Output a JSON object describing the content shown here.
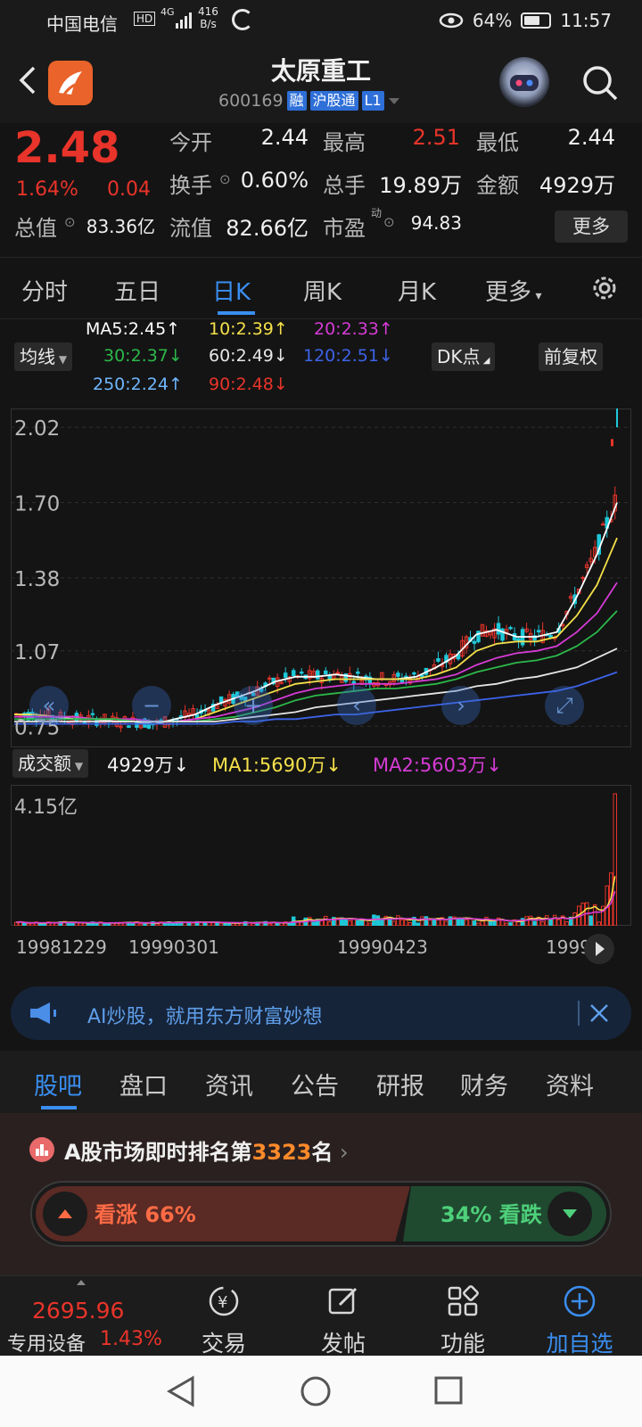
{
  "status_bar": {
    "carrier": "中国电信",
    "hd": "HD",
    "net_type": "4G",
    "speed_value": "416",
    "speed_unit": "B/s",
    "battery_pct": "64%",
    "battery_level": 0.64,
    "time": "11:57"
  },
  "header": {
    "title": "太原重工",
    "code": "600169",
    "tag_rong": "融",
    "tag_hgt": "沪股通",
    "tag_l1": "L1"
  },
  "quote": {
    "price": "2.48",
    "change_pct": "1.64%",
    "change": "0.04",
    "open_label": "今开",
    "open": "2.44",
    "high_label": "最高",
    "high": "2.51",
    "low_label": "最低",
    "low": "2.44",
    "turnover_label": "换手",
    "turnover": "0.60%",
    "volume_label": "总手",
    "volume": "19.89万",
    "amount_label": "金额",
    "amount": "4929万",
    "mktcap_label": "总值",
    "mktcap": "83.36亿",
    "float_label": "流值",
    "float_cap": "82.66亿",
    "pe_label": "市盈",
    "pe_sup": "动",
    "pe": "94.83",
    "more": "更多"
  },
  "period_tabs": [
    "分时",
    "五日",
    "日K",
    "周K",
    "月K",
    "更多"
  ],
  "active_tab": "日K",
  "ma_legend": {
    "mode": "均线",
    "dk": "DK点",
    "adjust": "前复权",
    "ma5": "MA5:2.45↑",
    "ma10": "10:2.39↑",
    "ma20": "20:2.33↑",
    "ma30": "30:2.37↓",
    "ma60": "60:2.49↓",
    "ma120": "120:2.51↓",
    "ma250": "250:2.24↑",
    "ma90": "90:2.48↓"
  },
  "colors": {
    "up": "#e8342a",
    "down": "#1fc8d8",
    "ma5": "#ffffff",
    "ma10": "#f5e04a",
    "ma20": "#d63bd6",
    "ma30": "#2cb84a",
    "ma60": "#e6e6e6",
    "ma120": "#3c63e8",
    "ma250": "#6fb7ff",
    "ma90": "#e8342a",
    "accent": "#3a8ef0"
  },
  "chart_data": [
    {
      "type": "candlestick",
      "y_ticks": [
        "2.02",
        "1.70",
        "1.38",
        "1.07",
        "0.75"
      ],
      "ylim": [
        0.75,
        2.02
      ],
      "x_ticks": [
        "19981229",
        "19990301",
        "19990423",
        "1999"
      ],
      "series": [
        {
          "name": "MA5",
          "values": [
            0.8,
            0.8,
            0.79,
            0.78,
            0.78,
            0.77,
            0.77,
            0.76,
            0.78,
            0.8,
            0.84,
            0.87,
            0.9,
            0.94,
            0.96,
            0.96,
            0.97,
            0.96,
            0.95,
            0.95,
            0.96,
            1.0,
            1.05,
            1.14,
            1.16,
            1.13,
            1.13,
            1.15,
            1.3,
            1.48,
            1.7
          ]
        },
        {
          "name": "MA10",
          "values": [
            0.8,
            0.8,
            0.79,
            0.79,
            0.78,
            0.78,
            0.77,
            0.77,
            0.77,
            0.78,
            0.81,
            0.84,
            0.87,
            0.9,
            0.93,
            0.94,
            0.95,
            0.95,
            0.95,
            0.95,
            0.95,
            0.97,
            1.0,
            1.07,
            1.1,
            1.11,
            1.11,
            1.13,
            1.22,
            1.35,
            1.55
          ]
        },
        {
          "name": "MA20",
          "values": [
            0.79,
            0.79,
            0.79,
            0.79,
            0.78,
            0.78,
            0.78,
            0.77,
            0.77,
            0.78,
            0.79,
            0.81,
            0.83,
            0.86,
            0.89,
            0.91,
            0.92,
            0.93,
            0.93,
            0.93,
            0.94,
            0.95,
            0.97,
            1.01,
            1.04,
            1.06,
            1.07,
            1.09,
            1.15,
            1.23,
            1.36
          ]
        },
        {
          "name": "MA30",
          "values": [
            0.78,
            0.78,
            0.78,
            0.78,
            0.78,
            0.78,
            0.77,
            0.77,
            0.77,
            0.77,
            0.78,
            0.79,
            0.81,
            0.83,
            0.86,
            0.88,
            0.89,
            0.9,
            0.91,
            0.91,
            0.92,
            0.93,
            0.95,
            0.98,
            1.0,
            1.02,
            1.03,
            1.05,
            1.09,
            1.15,
            1.24
          ]
        },
        {
          "name": "MA60",
          "values": [
            0.77,
            0.77,
            0.77,
            0.77,
            0.77,
            0.77,
            0.77,
            0.77,
            0.77,
            0.77,
            0.77,
            0.78,
            0.79,
            0.8,
            0.81,
            0.83,
            0.84,
            0.85,
            0.86,
            0.87,
            0.88,
            0.89,
            0.9,
            0.92,
            0.93,
            0.95,
            0.96,
            0.98,
            1.0,
            1.04,
            1.08
          ]
        },
        {
          "name": "MA120",
          "values": [
            0.76,
            0.76,
            0.76,
            0.76,
            0.76,
            0.76,
            0.76,
            0.76,
            0.76,
            0.76,
            0.76,
            0.77,
            0.77,
            0.78,
            0.78,
            0.79,
            0.8,
            0.8,
            0.81,
            0.82,
            0.83,
            0.84,
            0.85,
            0.86,
            0.87,
            0.88,
            0.89,
            0.9,
            0.92,
            0.95,
            0.98
          ]
        }
      ]
    },
    {
      "type": "bar",
      "title": "成交额",
      "max_label": "4.15亿",
      "current": "4929万↓",
      "ma1": "MA1:5690万↓",
      "ma2": "MA2:5603万↓"
    }
  ],
  "ai_banner": {
    "text": "AI炒股，就用东方财富妙想"
  },
  "content_tabs": [
    "股吧",
    "盘口",
    "资讯",
    "公告",
    "研报",
    "财务",
    "资料"
  ],
  "active_content_tab": "股吧",
  "rank": {
    "prefix": "A股市场即时排名第",
    "number": "3323",
    "suffix": "名",
    "bull": "看涨 66%",
    "bear": "34% 看跌"
  },
  "toolbar": {
    "index_value": "2695.96",
    "index_name": "专用设备",
    "index_pct": "1.43%",
    "trade": "交易",
    "post": "发帖",
    "function": "功能",
    "add": "加自选"
  }
}
